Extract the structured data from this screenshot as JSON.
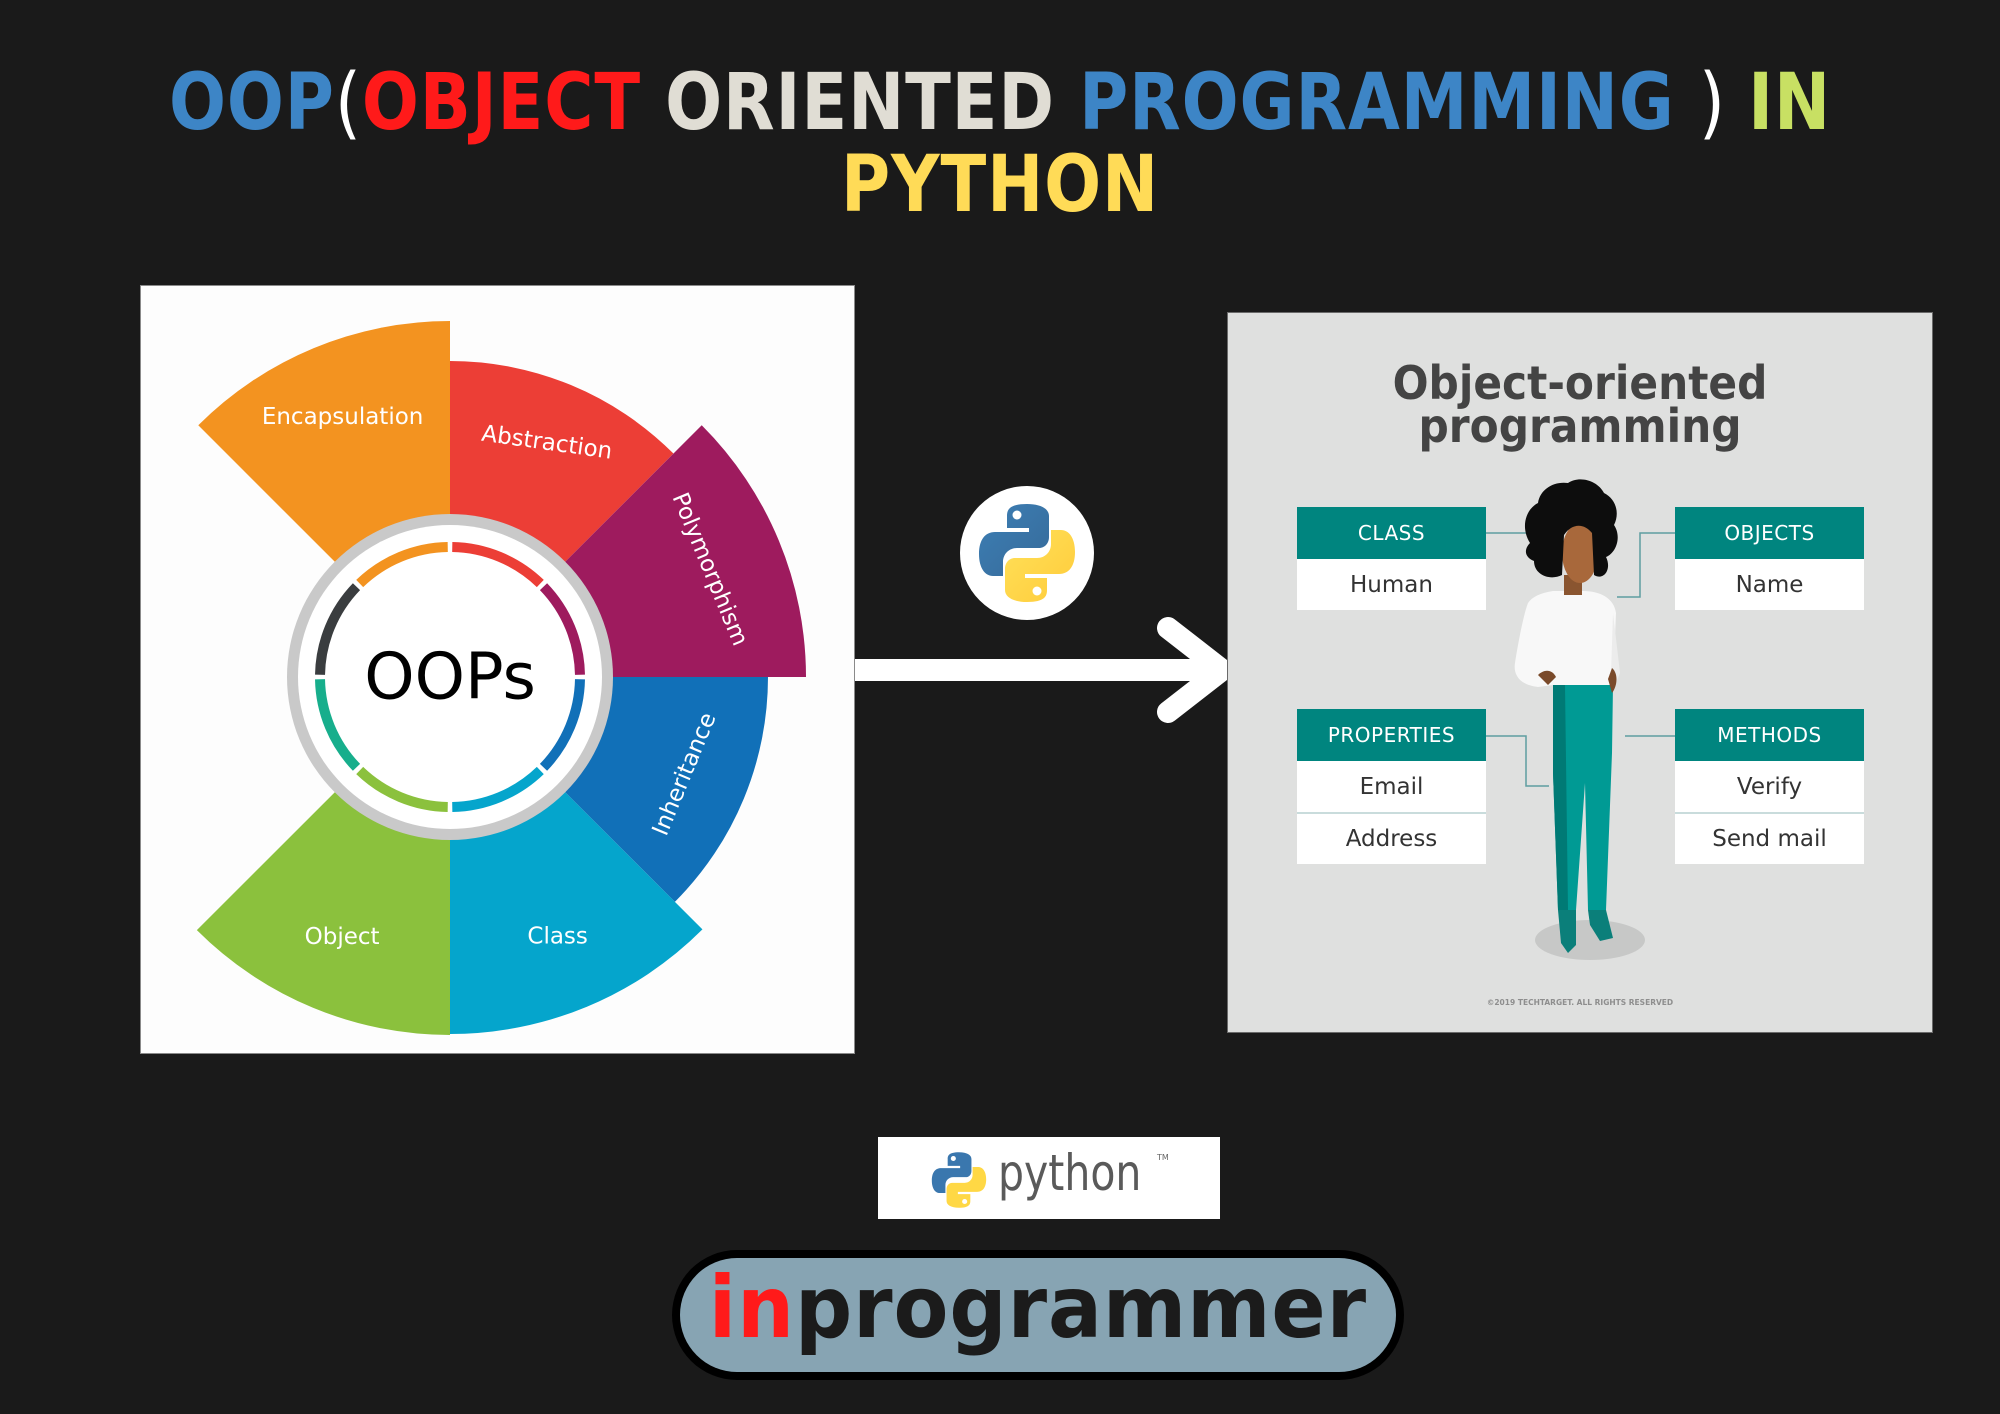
{
  "headline": {
    "line1": [
      {
        "text": "OOP",
        "color": "#3d85c6"
      },
      {
        "text": "(",
        "color": "#ffffff"
      },
      {
        "text": "OBJECT ",
        "color": "#ff1a1a"
      },
      {
        "text": "ORIENTED ",
        "color": "#e0ddd4"
      },
      {
        "text": "PROGRAMMING ",
        "color": "#3d85c6"
      },
      {
        "text": ") ",
        "color": "#ffffff"
      },
      {
        "text": "IN",
        "color": "#c8e063"
      }
    ],
    "line2": [
      {
        "text": "PYTHON",
        "color": "#ffdb57"
      }
    ]
  },
  "oops_wheel": {
    "center_label": "OOPs",
    "petals": [
      {
        "label": "Encapsulation",
        "color": "#f39320"
      },
      {
        "label": "Abstraction",
        "color": "#ec3e36"
      },
      {
        "label": "Polymorphism",
        "color": "#9e1b5e"
      },
      {
        "label": "Inheritance",
        "color": "#1170b8"
      },
      {
        "label": "Class",
        "color": "#05a5cc"
      },
      {
        "label": "Object",
        "color": "#8bc13d"
      }
    ],
    "ring_segments": [
      "#f39320",
      "#ec3e36",
      "#9e1b5e",
      "#1170b8",
      "#05a5cc",
      "#8bc13d",
      "#17ae8c",
      "#3a3d3f"
    ]
  },
  "connector": {
    "arrow_icon": "right-arrow",
    "badge_icon": "python-logo"
  },
  "oop_infographic": {
    "title_line1": "Object-oriented",
    "title_line2": "programming",
    "boxes": [
      {
        "id": "class",
        "header": "CLASS",
        "rows": [
          "Human"
        ]
      },
      {
        "id": "objects",
        "header": "OBJECTS",
        "rows": [
          "Name"
        ]
      },
      {
        "id": "properties",
        "header": "PROPERTIES",
        "rows": [
          "Email",
          "Address"
        ]
      },
      {
        "id": "methods",
        "header": "METHODS",
        "rows": [
          "Verify",
          "Send mail"
        ]
      }
    ],
    "accent": "#00857f",
    "copyright": "©2019 TECHTARGET. ALL RIGHTS RESERVED"
  },
  "python_logo": {
    "word": "python",
    "trademark": "TM"
  },
  "brand": {
    "prefix": "in",
    "rest": "programmer",
    "prefix_color": "#ff1a1a"
  }
}
